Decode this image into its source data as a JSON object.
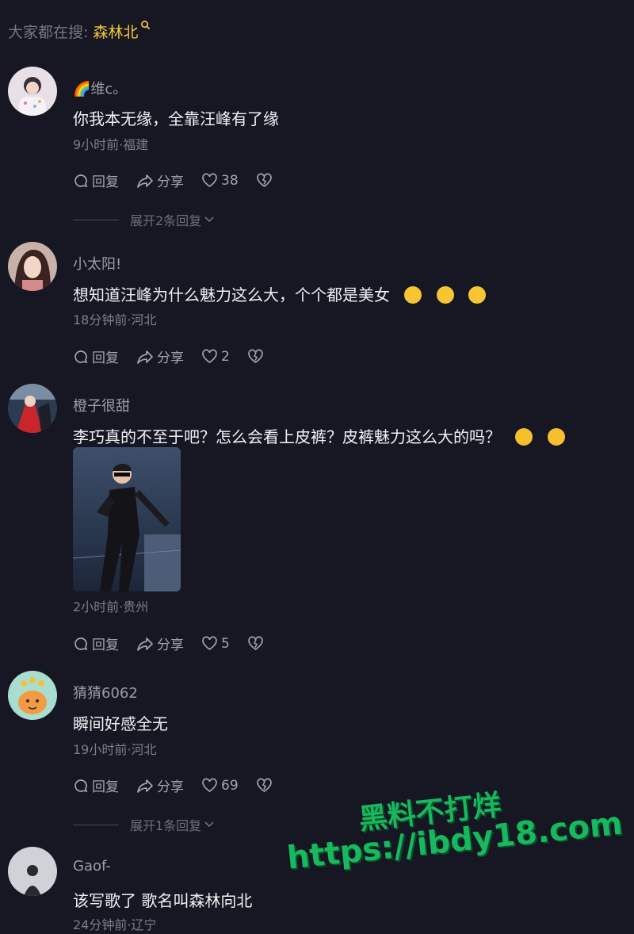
{
  "search_hint": {
    "label": "大家都在搜:",
    "keyword": "森林北"
  },
  "comments": [
    {
      "username": "🌈维c。",
      "text": "你我本无缘，全靠汪峰有了缘",
      "meta": "9小时前·福建",
      "reply": "回复",
      "share": "分享",
      "likes": "38",
      "expand": "展开2条回复"
    },
    {
      "username": "小太阳!",
      "text": "想知道汪峰为什么魅力这么大，个个都是美女",
      "meta": "18分钟前·河北",
      "reply": "回复",
      "share": "分享",
      "likes": "2"
    },
    {
      "username": "橙子很甜",
      "text": "李巧真的不至于吧？怎么会看上皮裤？皮裤魅力这么大的吗？",
      "meta": "2小时前·贵州",
      "reply": "回复",
      "share": "分享",
      "likes": "5"
    },
    {
      "username": "猜猜6062",
      "text": "瞬间好感全无",
      "meta": "19小时前·河北",
      "reply": "回复",
      "share": "分享",
      "likes": "69",
      "expand": "展开1条回复"
    },
    {
      "username": "Gaof-",
      "text": "该写歌了 歌名叫森林向北",
      "meta": "24分钟前·辽宁"
    }
  ],
  "watermark": {
    "line1": "黑料不打烊",
    "line2": "https://ibdy18.com"
  },
  "colors": {
    "background": "#161722",
    "keyword": "#f1c73d",
    "watermark": "#18b85f"
  }
}
